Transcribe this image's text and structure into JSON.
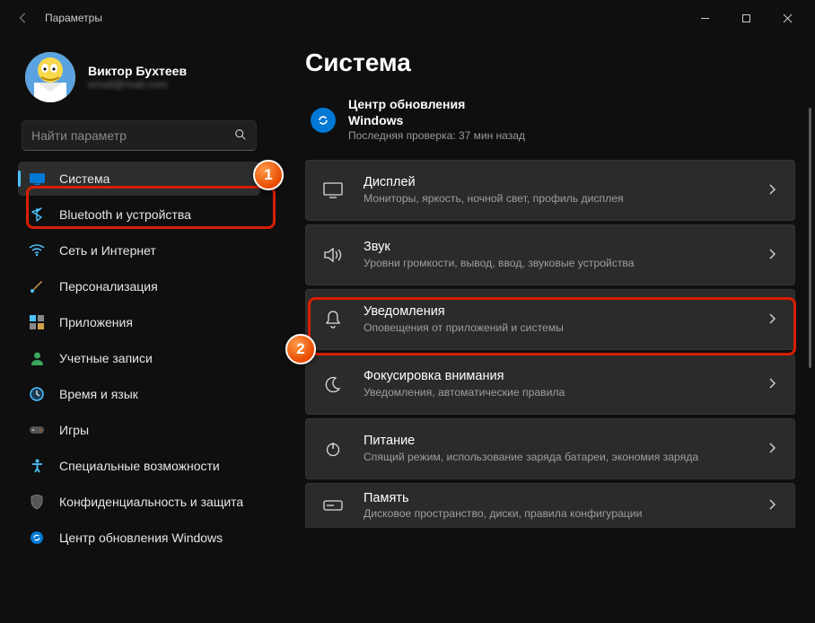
{
  "window": {
    "app_title": "Параметры"
  },
  "user": {
    "name": "Виктор Бухтеев",
    "email": "email@mail.com"
  },
  "search": {
    "placeholder": "Найти параметр"
  },
  "sidebar": {
    "items": [
      {
        "label": "Система",
        "icon": "system",
        "active": true
      },
      {
        "label": "Bluetooth и устройства",
        "icon": "bluetooth"
      },
      {
        "label": "Сеть и Интернет",
        "icon": "wifi"
      },
      {
        "label": "Персонализация",
        "icon": "brush"
      },
      {
        "label": "Приложения",
        "icon": "apps"
      },
      {
        "label": "Учетные записи",
        "icon": "person"
      },
      {
        "label": "Время и язык",
        "icon": "clock"
      },
      {
        "label": "Игры",
        "icon": "gamepad"
      },
      {
        "label": "Специальные возможности",
        "icon": "accessibility"
      },
      {
        "label": "Конфиденциальность и защита",
        "icon": "shield"
      },
      {
        "label": "Центр обновления Windows",
        "icon": "update"
      }
    ]
  },
  "page": {
    "title": "Система",
    "update": {
      "title": "Центр обновления Windows",
      "subtitle": "Последняя проверка: 37 мин назад"
    },
    "cards": [
      {
        "title": "Дисплей",
        "subtitle": "Мониторы, яркость, ночной свет, профиль дисплея",
        "icon": "display"
      },
      {
        "title": "Звук",
        "subtitle": "Уровни громкости, вывод, ввод, звуковые устройства",
        "icon": "sound"
      },
      {
        "title": "Уведомления",
        "subtitle": "Оповещения от приложений и системы",
        "icon": "bell"
      },
      {
        "title": "Фокусировка внимания",
        "subtitle": "Уведомления, автоматические правила",
        "icon": "moon"
      },
      {
        "title": "Питание",
        "subtitle": "Спящий режим, использование заряда батареи, экономия заряда",
        "icon": "power"
      },
      {
        "title": "Память",
        "subtitle": "Дисковое пространство, диски, правила конфигурации",
        "icon": "storage"
      }
    ]
  },
  "annotations": {
    "marker1": "1",
    "marker2": "2"
  }
}
